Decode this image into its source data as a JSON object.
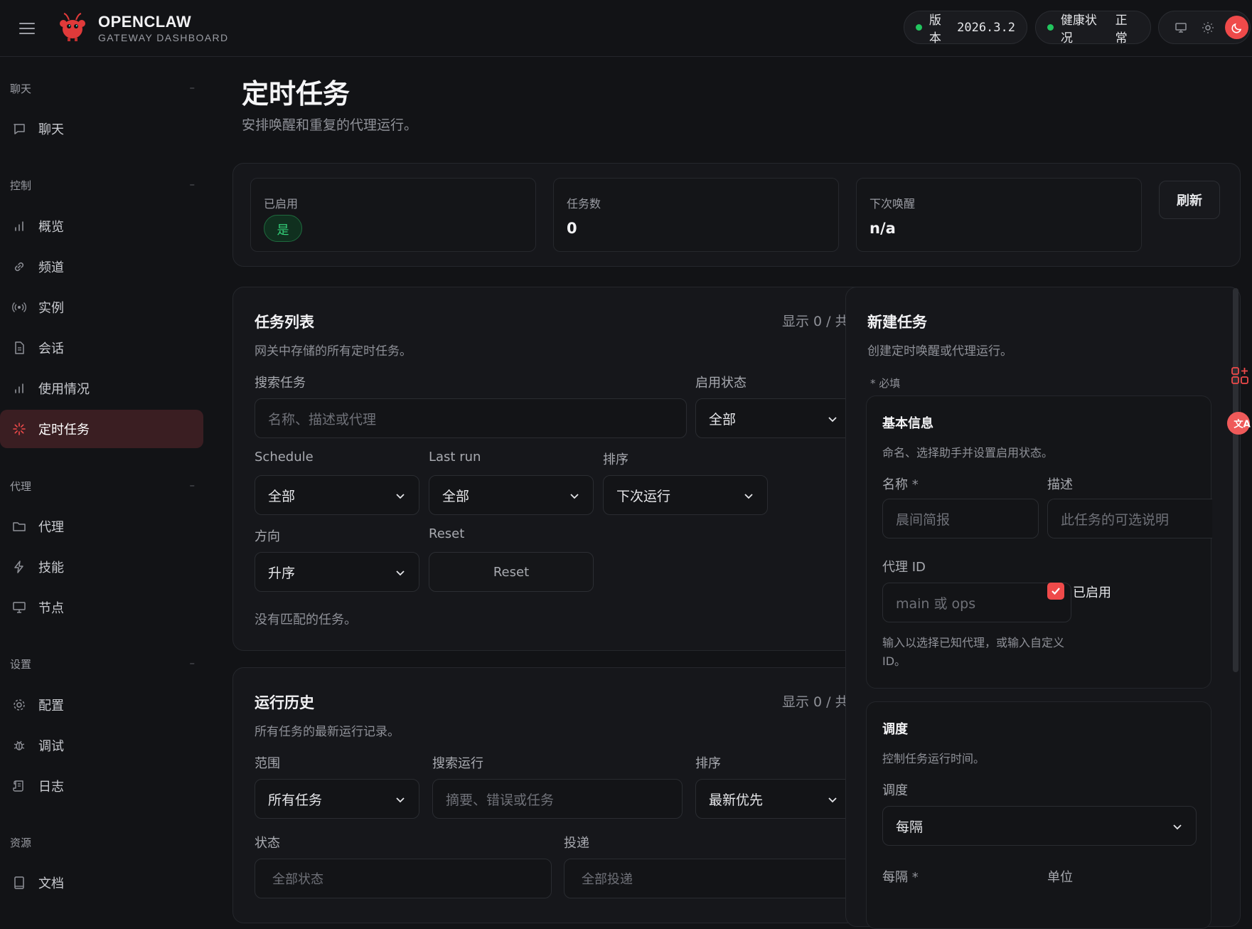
{
  "app": {
    "title": "OPENCLAW",
    "subtitle": "GATEWAY DASHBOARD"
  },
  "header": {
    "version_label": "版本",
    "version_value": "2026.3.2",
    "health_label": "健康状况",
    "health_value": "正常",
    "status_color": "#22c55e",
    "accent": "#ef4a4a",
    "theme_icons": [
      "monitor-icon",
      "sun-icon",
      "moon-icon"
    ]
  },
  "sidebar": {
    "groups": [
      {
        "title": "聊天",
        "items": [
          {
            "label": "聊天",
            "icon": "chat-icon"
          }
        ]
      },
      {
        "title": "控制",
        "items": [
          {
            "label": "概览",
            "icon": "bar-chart-icon"
          },
          {
            "label": "频道",
            "icon": "link-icon"
          },
          {
            "label": "实例",
            "icon": "radio-icon"
          },
          {
            "label": "会话",
            "icon": "document-icon"
          },
          {
            "label": "使用情况",
            "icon": "bar-chart-icon"
          },
          {
            "label": "定时任务",
            "icon": "loader-icon",
            "active": true
          }
        ]
      },
      {
        "title": "代理",
        "items": [
          {
            "label": "代理",
            "icon": "folder-icon"
          },
          {
            "label": "技能",
            "icon": "bolt-icon"
          },
          {
            "label": "节点",
            "icon": "monitor-icon"
          }
        ]
      },
      {
        "title": "设置",
        "items": [
          {
            "label": "配置",
            "icon": "gear-icon"
          },
          {
            "label": "调试",
            "icon": "bug-icon"
          },
          {
            "label": "日志",
            "icon": "scroll-icon"
          }
        ]
      },
      {
        "title": "资源",
        "items": [
          {
            "label": "文档",
            "icon": "book-icon"
          }
        ]
      }
    ],
    "collapse_glyph": "–"
  },
  "page": {
    "title": "定时任务",
    "subtitle": "安排唤醒和重复的代理运行。"
  },
  "stats": {
    "enabled_label": "已启用",
    "enabled_value": "是",
    "jobs_label": "任务数",
    "jobs_value": "0",
    "next_label": "下次唤醒",
    "next_value": "n/a",
    "refresh_label": "刷新"
  },
  "task_list": {
    "title": "任务列表",
    "desc": "网关中存储的所有定时任务。",
    "count": "显示 0 / 共",
    "search_label": "搜索任务",
    "search_placeholder": "名称、描述或代理",
    "enabled_label": "启用状态",
    "enabled_value": "全部",
    "schedule_label": "Schedule",
    "schedule_value": "全部",
    "lastrun_label": "Last run",
    "lastrun_value": "全部",
    "sort_label": "排序",
    "sort_value": "下次运行",
    "dir_label": "方向",
    "dir_value": "升序",
    "reset_label": "Reset",
    "reset_button": "Reset",
    "empty": "没有匹配的任务。"
  },
  "history": {
    "title": "运行历史",
    "desc": "所有任务的最新运行记录。",
    "count": "显示 0 / 共",
    "scope_label": "范围",
    "scope_value": "所有任务",
    "search_label": "搜索运行",
    "search_placeholder": "摘要、错误或任务",
    "sort_label": "排序",
    "sort_value": "最新优先",
    "status_label": "状态",
    "status_placeholder": "全部状态",
    "delivery_label": "投递",
    "delivery_placeholder": "全部投递"
  },
  "new_task": {
    "title": "新建任务",
    "desc": "创建定时唤醒或代理运行。",
    "required_note": "* 必填",
    "basic_title": "基本信息",
    "basic_desc": "命名、选择助手并设置启用状态。",
    "name_label": "名称",
    "required_mark": "*",
    "name_placeholder": "晨间简报",
    "desc_label": "描述",
    "desc_placeholder": "此任务的可选说明",
    "agent_label": "代理 ID",
    "agent_placeholder": "main 或 ops",
    "enabled_check_label": "已启用",
    "agent_hint": "输入以选择已知代理，或输入自定义 ID。",
    "schedule_title": "调度",
    "schedule_desc": "控制任务运行时间。",
    "schedule_label": "调度",
    "schedule_value": "每隔",
    "every_label": "每隔",
    "unit_label": "单位"
  }
}
